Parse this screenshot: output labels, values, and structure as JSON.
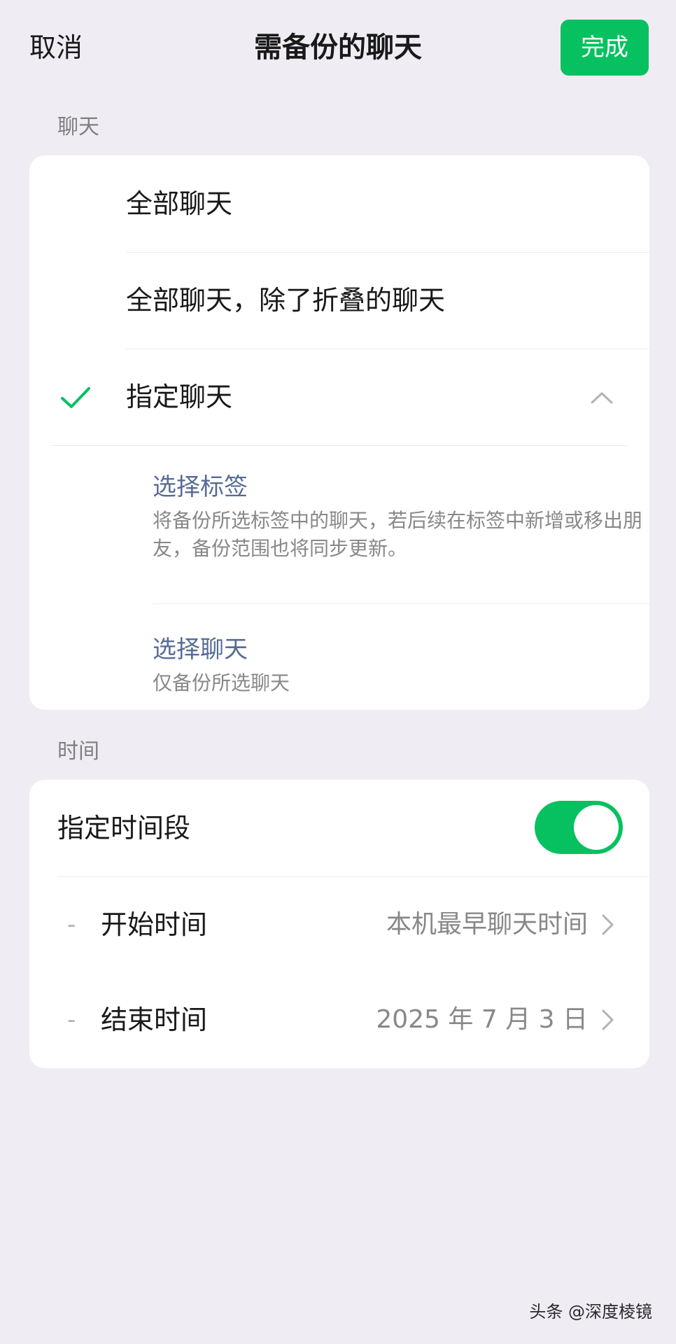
{
  "nav": {
    "cancel_label": "取消",
    "title": "需备份的聊天",
    "done_label": "完成"
  },
  "chat_section": {
    "label": "聊天",
    "options": [
      {
        "label": "全部聊天",
        "selected": false
      },
      {
        "label": "全部聊天，除了折叠的聊天",
        "selected": false
      },
      {
        "label": "指定聊天",
        "selected": true,
        "expanded": true
      }
    ],
    "sub_options": [
      {
        "title": "选择标签",
        "description": "将备份所选标签中的聊天，若后续在标签中新增或移出朋友，备份范围也将同步更新。"
      },
      {
        "title": "选择聊天",
        "description": "仅备份所选聊天"
      }
    ]
  },
  "time_section": {
    "label": "时间",
    "toggle_label": "指定时间段",
    "toggle_on": true,
    "rows": [
      {
        "dash": "-",
        "label": "开始时间",
        "value": "本机最早聊天时间"
      },
      {
        "dash": "-",
        "label": "结束时间",
        "value": "2025 年 7 月 3 日"
      }
    ]
  },
  "watermark": "头条 @深度棱镜",
  "colors": {
    "accent": "#07c160",
    "link": "#576b95",
    "background": "#efedf3"
  }
}
